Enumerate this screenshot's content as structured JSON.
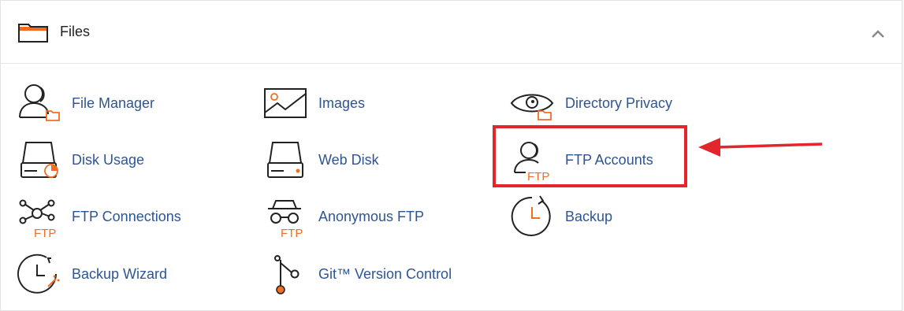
{
  "section": {
    "title": "Files",
    "header_icon": "folder-icon",
    "collapse_icon": "chevron-up-icon"
  },
  "items": [
    {
      "label": "File Manager",
      "icon": "file-manager-icon"
    },
    {
      "label": "Images",
      "icon": "images-icon"
    },
    {
      "label": "Directory Privacy",
      "icon": "directory-privacy-icon"
    },
    {
      "label": "Disk Usage",
      "icon": "disk-usage-icon"
    },
    {
      "label": "Web Disk",
      "icon": "web-disk-icon"
    },
    {
      "label": "FTP Accounts",
      "icon": "ftp-accounts-icon"
    },
    {
      "label": "FTP Connections",
      "icon": "ftp-connections-icon"
    },
    {
      "label": "Anonymous FTP",
      "icon": "anonymous-ftp-icon"
    },
    {
      "label": "Backup",
      "icon": "backup-icon"
    },
    {
      "label": "Backup Wizard",
      "icon": "backup-wizard-icon"
    },
    {
      "label": "Git™ Version Control",
      "icon": "git-version-control-icon"
    }
  ],
  "icon_text": {
    "ftp": "FTP"
  },
  "colors": {
    "accent_orange": "#f26d21",
    "link_blue": "#2e5593",
    "highlight_red": "#e3262b"
  },
  "annotation": {
    "highlighted_item": "FTP Accounts",
    "arrow_icon": "arrow-left-icon"
  }
}
